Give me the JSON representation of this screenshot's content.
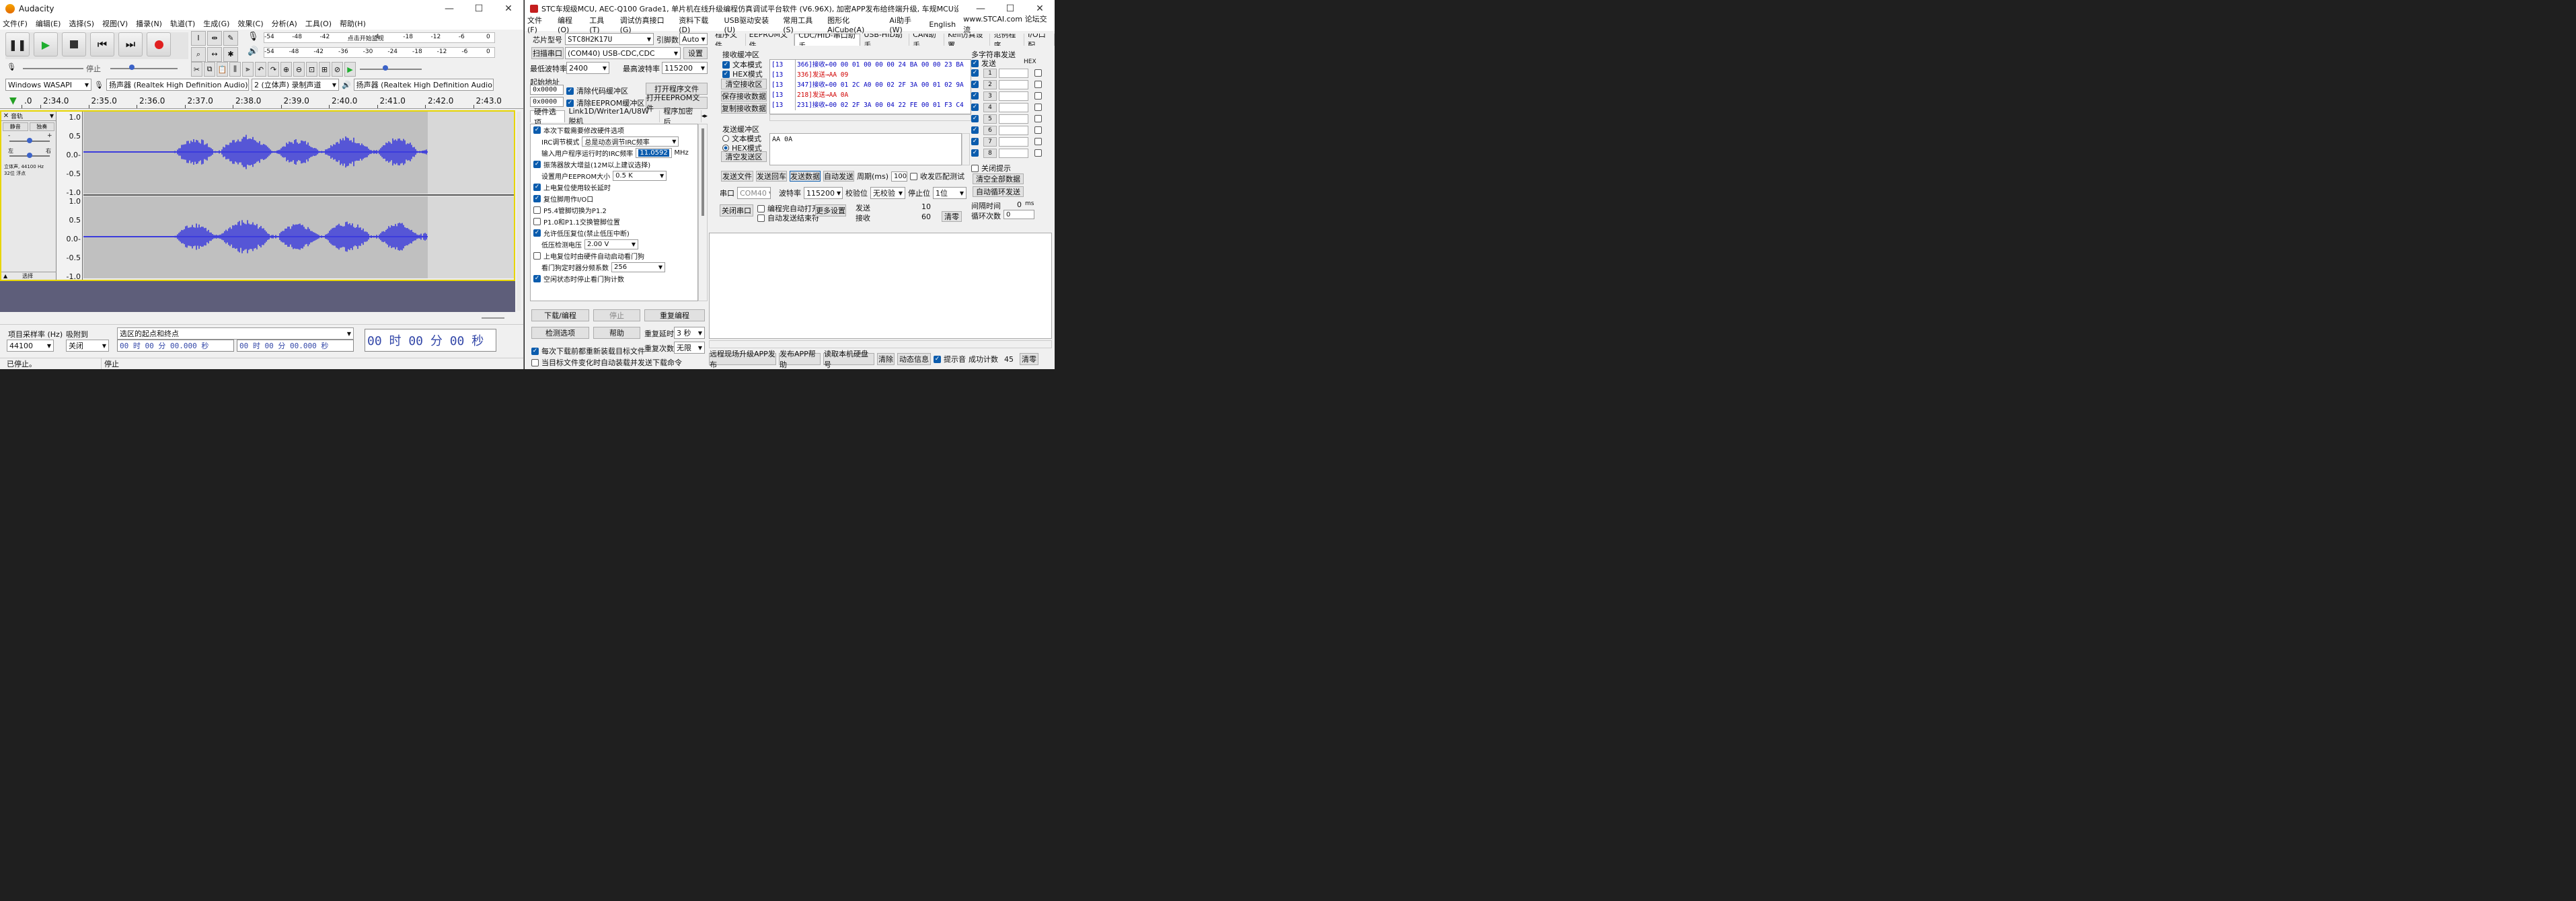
{
  "audacity": {
    "title": "Audacity",
    "menu": [
      "文件(F)",
      "编辑(E)",
      "选择(S)",
      "视图(V)",
      "播录(N)",
      "轨道(T)",
      "生成(G)",
      "效果(C)",
      "分析(A)",
      "工具(O)",
      "帮助(H)"
    ],
    "meter_play_ticks": [
      "-54",
      "-48",
      "-42",
      "点击开始监视",
      "4",
      "-18",
      "-12",
      "-6",
      "0"
    ],
    "meter_rec_ticks": [
      "-54",
      "-48",
      "-42",
      "-36",
      "-30",
      "-24",
      "-18",
      "-12",
      "-6",
      "0"
    ],
    "stop_label": "停止",
    "host": "Windows WASAPI",
    "rec_device": "扬声器 (Realtek High Definition Audio) (l",
    "channels": "2 (立体声) 录制声道",
    "play_device": "扬声器 (Realtek High Definition Audio)",
    "timeline_ticks": [
      ".0",
      "2:34.0",
      "2:35.0",
      "2:36.0",
      "2:37.0",
      "2:38.0",
      "2:39.0",
      "2:40.0",
      "2:41.0",
      "2:42.0",
      "2:43.0"
    ],
    "track": {
      "name": "音轨",
      "mute": "静音",
      "solo": "独奏",
      "gain_l": "-",
      "gain_r": "+",
      "pan_l": "左",
      "pan_r": "右",
      "info1": "立体声, 44100 Hz",
      "info2": "32位 浮点",
      "select": "选择"
    },
    "y_axis": [
      "1.0",
      "0.5",
      "0.0-",
      "-0.5",
      "-1.0"
    ],
    "sel_bar": {
      "rate_label": "项目采样率 (Hz)",
      "rate_value": "44100",
      "snap_label": "吸附到",
      "snap_value": "关闭",
      "range_label": "选区的起点和终点",
      "start": "00 时 00 分 00.000 秒",
      "end": "00 时 00 分 00.000 秒",
      "big_time": "00 时 00 分 00 秒"
    },
    "status_left": "已停止。",
    "status_mid": "停止"
  },
  "stc": {
    "title": "STC车规级MCU, AEC-Q100 Grade1, 单片机在线升级编程仿真调试平台软件 (V6.96X), 加密APP发布给终端升级, 车规MCU设计订制",
    "menu": [
      "文件(F)",
      "编程(O)",
      "工具(T)",
      "调试仿真接口(G)",
      "资料下载(D)",
      "USB驱动安装(U)",
      "常用工具(S)",
      "图形化AiCube(A)",
      "Ai助手(W)",
      "English",
      "www.STCAI.com 论坛交流"
    ],
    "chip_label": "芯片型号",
    "chip_value": "STC8H2K17U",
    "pin_label": "引脚数",
    "pin_value": "Auto",
    "scan_btn": "扫描串口",
    "port_value": "(COM40) USB-CDC,CDC",
    "settings_btn": "设置",
    "min_baud_label": "最低波特率",
    "min_baud": "2400",
    "max_baud_label": "最高波特率",
    "max_baud": "115200",
    "start_addr": "起始地址",
    "addr1": "0x0000",
    "addr2": "0x0000",
    "clear_code": "清除代码缓冲区",
    "clear_eeprom": "清除EEPROM缓冲区",
    "open_prog": "打开程序文件",
    "open_eeprom": "打开EEPROM文件",
    "hw_tabs": [
      "硬件选项",
      "Link1D/Writer1A/U8W脱机",
      "程序加密后"
    ],
    "hw_options": [
      {
        "label": "本次下载需要修改硬件选项",
        "on": true
      },
      {
        "label": "IRC调节模式",
        "value": "总是动态调节IRC频率"
      },
      {
        "label": "输入用户程序运行时的IRC频率",
        "value": "11.0592",
        "unit": "MHz"
      },
      {
        "label": "振荡器放大增益(12M以上建议选择)",
        "on": true
      },
      {
        "label": "设置用户EEPROM大小",
        "value": "0.5 K"
      },
      {
        "label": "上电复位使用较长延时",
        "on": true
      },
      {
        "label": "复位脚用作I/O口",
        "on": true
      },
      {
        "label": "P5.4管脚切换为P1.2",
        "on": false
      },
      {
        "label": "P1.0和P1.1交换管脚位置",
        "on": false
      },
      {
        "label": "允许低压复位(禁止低压中断)",
        "on": true
      },
      {
        "label": "低压检测电压",
        "value": "2.00 V"
      },
      {
        "label": "上电复位时由硬件自动启动看门狗",
        "on": false
      },
      {
        "label": "看门狗定时器分频系数",
        "value": "256"
      },
      {
        "label": "空闲状态时停止看门狗计数",
        "on": true
      }
    ],
    "download_btn": "下载/编程",
    "stop_btn": "停止",
    "reprog_btn": "重复编程",
    "check_btn": "检测选项",
    "help_btn": "帮助",
    "delay_label": "重复延时",
    "delay_value": "3 秒",
    "count_label": "重复次数",
    "count_value": "无限",
    "reload_each": "每次下载前都重新装载目标文件",
    "reload_change": "当目标文件变化时自动装载并发送下载命令",
    "right_tabs": [
      "程序文件",
      "EEPROM文件",
      "CDC/HID-串口助手",
      "USB-HID助手",
      "CAN助手",
      "Keil仿真设置",
      "范例程序",
      "I/O口配"
    ],
    "recv_title": "接收缓冲区",
    "text_mode": "文本模式",
    "hex_mode": "HEX模式",
    "clear_recv": "清空接收区",
    "save_recv": "保存接收数据",
    "copy_recv": "复制接收数据",
    "recv_lines": [
      {
        "pre": "[13",
        "t": "366]接收←00 00 01 00 00 00 24 BA 00 00 23 BA",
        "c": "#0000c0"
      },
      {
        "pre": "[13",
        "t": "336]发送→AA 09",
        "c": "#d00000"
      },
      {
        "pre": "[13",
        "t": "347]接收←00 01 2C A0 00 02 2F 3A 00 01 02 9A",
        "c": "#0000c0"
      },
      {
        "pre": "[13",
        "t": "218]发送→AA 0A",
        "c": "#d00000"
      },
      {
        "pre": "[13",
        "t": "231]接收←00 02 2F 3A 00 04 22 FE 00 01 F3 C4",
        "c": "#0000c0"
      }
    ],
    "send_title": "发送缓冲区",
    "send_text": "AA 0A",
    "clear_send": "清空发送区",
    "send_file": "发送文件",
    "send_enter": "发送回车",
    "send_data": "发送数据",
    "auto_send": "自动发送",
    "period_label": "周期(ms)",
    "period": "100",
    "match": "收发匹配测试",
    "port_label": "串口",
    "port": "COM40",
    "baud_label": "波特率",
    "baud": "115200",
    "parity_label": "校验位",
    "parity": "无校验",
    "stop_label": "停止位",
    "stop": "1位",
    "close_port": "关闭串口",
    "auto_open": "编程完自动打开",
    "auto_end": "自动发送结束符",
    "more": "更多设置",
    "sent_label": "发送",
    "sent": "10",
    "recv_label": "接收",
    "recv": "60",
    "clear_count": "清零",
    "multi_title": "多字符串发送",
    "send_col": "发送",
    "hex_col": "HEX",
    "multi": [
      "1",
      "2",
      "3",
      "4",
      "5",
      "6",
      "7",
      "8"
    ],
    "close_tip": "关闭提示",
    "clear_all": "清空全部数据",
    "auto_loop": "自动循环发送",
    "interval_label": "间隔时间",
    "interval": "0",
    "interval_unit": "ms",
    "loops_label": "循环次数",
    "loops": "0",
    "bottom": {
      "remote": "远程现场升级APP发布",
      "publish": "发布APP帮助",
      "read_hdd": "读取本机硬盘号",
      "clear": "清除",
      "dynamic": "动态信息",
      "tips": "提示音",
      "success_label": "成功计数",
      "success": "45",
      "clear2": "清零"
    }
  },
  "colors": {
    "wave": "#3c3cdc",
    "track_bg": "#c0c0c0",
    "accent": "#0b5cad"
  }
}
